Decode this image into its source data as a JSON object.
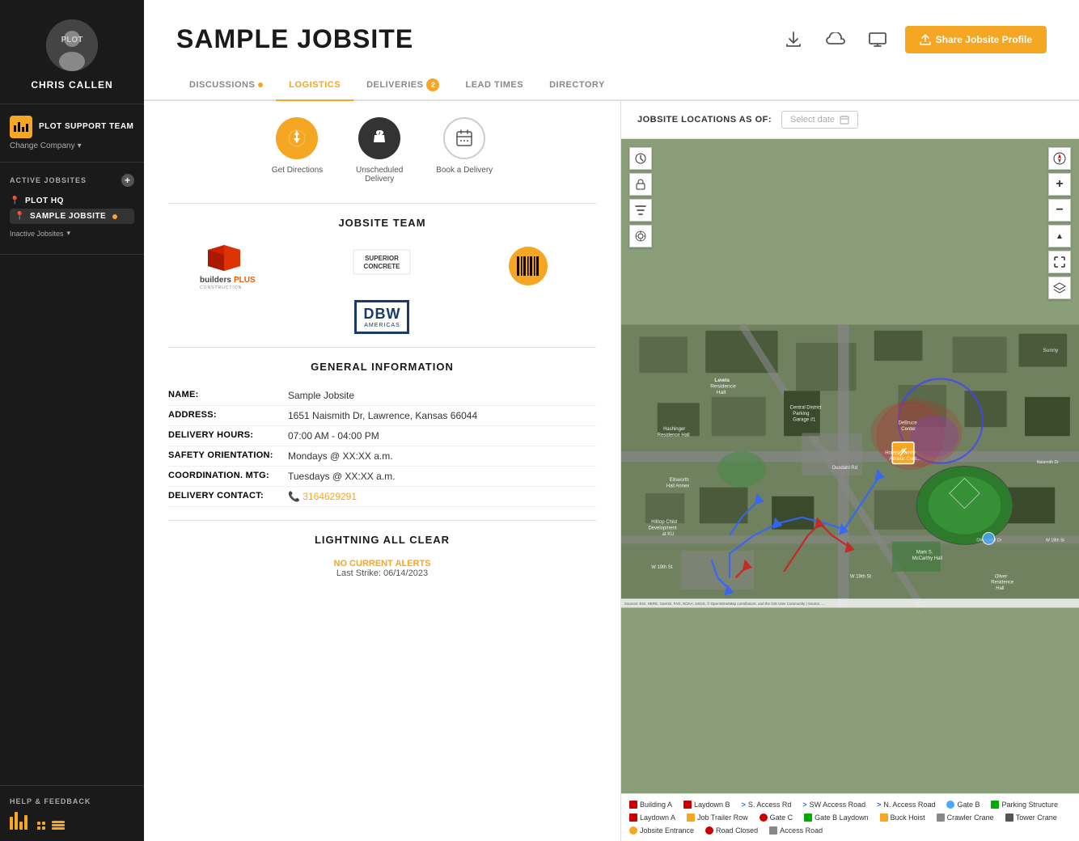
{
  "sidebar": {
    "user": {
      "name": "CHRIS CALLEN"
    },
    "team": {
      "name": "PLOT SUPPORT TEAM",
      "change_company": "Change Company"
    },
    "active_jobsites_label": "ACTIVE JOBSITES",
    "jobsites": [
      {
        "name": "PLOT HQ",
        "active": false
      },
      {
        "name": "SAMPLE JOBSITE",
        "active": true
      }
    ],
    "inactive_label": "Inactive Jobsites",
    "help_label": "HELP & FEEDBACK"
  },
  "header": {
    "title": "SAMPLE JOBSITE",
    "share_btn": "Share Jobsite Profile"
  },
  "tabs": [
    {
      "label": "DISCUSSIONS",
      "active": false,
      "dot": true
    },
    {
      "label": "LOGISTICS",
      "active": true,
      "dot": false
    },
    {
      "label": "DELIVERIES",
      "active": false,
      "badge": "2"
    },
    {
      "label": "LEAD TIMES",
      "active": false
    },
    {
      "label": "DIRECTORY",
      "active": false
    }
  ],
  "actions": [
    {
      "label": "Get Directions",
      "type": "orange",
      "icon": "⟳"
    },
    {
      "label": "Unscheduled Delivery",
      "type": "dark",
      "icon": "🔔"
    },
    {
      "label": "Book a Delivery",
      "type": "white",
      "icon": "📅"
    }
  ],
  "jobsite_team_label": "JOBSITE TEAM",
  "general_info": {
    "section_label": "GENERAL INFORMATION",
    "name_label": "NAME:",
    "name_value": "Sample Jobsite",
    "address_label": "ADDRESS:",
    "address_value": "1651 Naismith Dr, Lawrence, Kansas 66044",
    "delivery_hours_label": "DELIVERY HOURS:",
    "delivery_hours_value": "07:00 AM - 04:00 PM",
    "safety_label": "SAFETY ORIENTATION:",
    "safety_value": "Mondays @ XX:XX a.m.",
    "coordination_label": "COORDINATION. MTG:",
    "coordination_value": "Tuesdays @ XX:XX a.m.",
    "delivery_contact_label": "DELIVERY CONTACT:",
    "delivery_contact_value": "3164629291"
  },
  "lightning": {
    "section_label": "LIGHTNING ALL CLEAR",
    "no_alerts_label": "NO CURRENT",
    "no_alerts_highlight": "ALERTS",
    "last_strike_label": "Last Strike:",
    "last_strike_date": "06/14/2023"
  },
  "map": {
    "header_label": "JOBSITE LOCATIONS AS OF:",
    "date_placeholder": "Select date",
    "source": "Sources: Esri, HERE, Garmin, FAO, NOAA, USGS, © OpenStreetMap contributors, and the GIS User Community | Source: ...",
    "legend": [
      {
        "label": "Building A",
        "color": "#cc0000"
      },
      {
        "label": "Laydown B",
        "color": "#cc0000"
      },
      {
        "label": "> S. Access Rd",
        "color": "#555"
      },
      {
        "label": "> SW Access Road",
        "color": "#555"
      },
      {
        "label": "> N. Access Road",
        "color": "#555"
      },
      {
        "label": "Gate B",
        "color": "#4da6ff"
      },
      {
        "label": "Parking Structure",
        "color": "#00aa00"
      },
      {
        "label": "Laydown A",
        "color": "#cc0000"
      },
      {
        "label": "Job Trailer Row",
        "color": "#f5a623"
      },
      {
        "label": "Gate C",
        "color": "#cc0000"
      },
      {
        "label": "Gate B Laydown",
        "color": "#00aa00"
      },
      {
        "label": "Buck Hoist",
        "color": "#f5a623"
      },
      {
        "label": "Crawler Crane",
        "color": "#888"
      },
      {
        "label": "Tower Crane",
        "color": "#555"
      },
      {
        "label": "Jobsite Entrance",
        "color": "#f5a623"
      },
      {
        "label": "Road Closed",
        "color": "#cc0000"
      },
      {
        "label": "Access Road",
        "color": "#888"
      }
    ]
  }
}
